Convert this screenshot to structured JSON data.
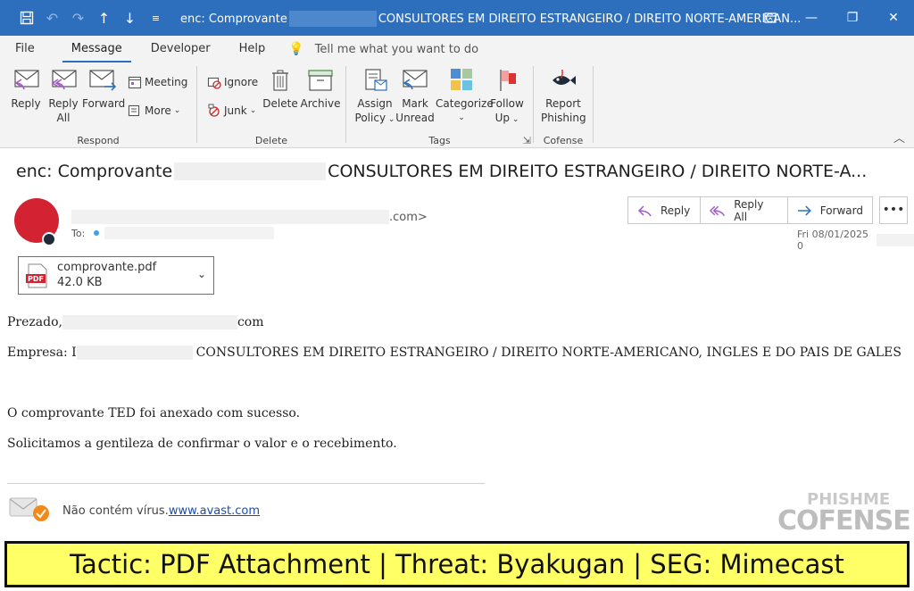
{
  "titlebar": {
    "title_prefix": "enc: Comprovante",
    "title_suffix": "CONSULTORES EM DIREITO ESTRANGEIRO / DIREITO NORTE-AMERICAN..."
  },
  "tabs": [
    "File",
    "Message",
    "Developer",
    "Help"
  ],
  "active_tab": "Message",
  "tell_me": "Tell me what you want to do",
  "ribbon": {
    "respond": {
      "label": "Respond",
      "reply": "Reply",
      "reply_all_1": "Reply",
      "reply_all_2": "All",
      "forward": "Forward",
      "meeting": "Meeting",
      "more": "More"
    },
    "delete": {
      "label": "Delete",
      "ignore": "Ignore",
      "junk": "Junk",
      "delete": "Delete",
      "archive": "Archive"
    },
    "tags": {
      "label": "Tags",
      "assign_1": "Assign",
      "assign_2": "Policy",
      "mark_1": "Mark",
      "mark_2": "Unread",
      "categorize": "Categorize",
      "follow_1": "Follow",
      "follow_2": "Up"
    },
    "cofense": {
      "label": "Cofense",
      "report_1": "Report",
      "report_2": "Phishing"
    }
  },
  "message": {
    "subject_prefix": "enc: Comprovante",
    "subject_suffix": "CONSULTORES EM DIREITO ESTRANGEIRO / DIREITO NORTE-A...",
    "sender_suffix": ".com>",
    "to_label": "To:",
    "date": "Fri 08/01/2025 0",
    "actions": {
      "reply": "Reply",
      "reply_all": "Reply All",
      "forward": "Forward",
      "more": "•••"
    }
  },
  "attachment": {
    "name": "comprovante.pdf",
    "size": "42.0 KB",
    "icon_label": "PDF"
  },
  "body": {
    "greeting_prefix": "Prezado,",
    "greeting_suffix": "com",
    "empresa_prefix": "Empresa: I",
    "empresa_suffix": "CONSULTORES EM DIREITO ESTRANGEIRO / DIREITO NORTE-AMERICANO, INGLES E DO PAIS DE GALES",
    "line1": "O comprovante TED foi anexado com sucesso.",
    "line2": "Solicitamos a gentileza de confirmar o valor e o recebimento."
  },
  "avast": {
    "text": "Não contém vírus.",
    "link": "www.avast.com"
  },
  "logo": {
    "line1": "PHISHME",
    "line2": "COFENSE"
  },
  "banner": "Tactic: PDF Attachment | Threat: Byakugan | SEG: Mimecast",
  "colors": {
    "titlebar": "#2d6fbd",
    "banner_bg": "#ffff66",
    "avatar": "#d32332",
    "link": "#1a4ea8"
  }
}
